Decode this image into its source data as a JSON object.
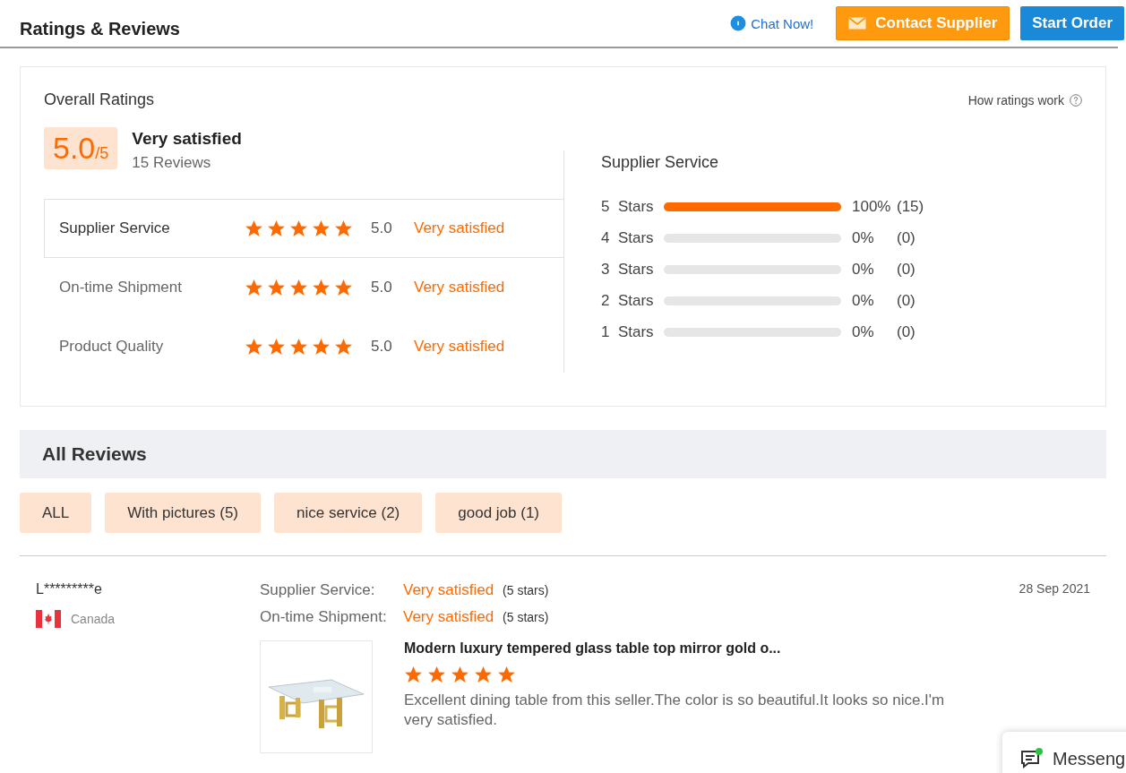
{
  "header": {
    "title": "Ratings & Reviews",
    "chat_link": "Chat Now!",
    "contact_button": "Contact Supplier",
    "order_button": "Start Order"
  },
  "overall": {
    "title": "Overall Ratings",
    "help_link": "How ratings work",
    "score": "5.0",
    "score_max": "/5",
    "verdict": "Very satisfied",
    "review_count": "15 Reviews",
    "criteria": [
      {
        "name": "Supplier Service",
        "stars": 5,
        "score": "5.0",
        "verdict": "Very satisfied",
        "selected": true
      },
      {
        "name": "On-time Shipment",
        "stars": 5,
        "score": "5.0",
        "verdict": "Very satisfied",
        "selected": false
      },
      {
        "name": "Product Quality",
        "stars": 5,
        "score": "5.0",
        "verdict": "Very satisfied",
        "selected": false
      }
    ],
    "breakdown": {
      "title": "Supplier Service",
      "rows": [
        {
          "label": "5  Stars",
          "level": 1,
          "percent": "100%",
          "count": "(15)"
        },
        {
          "label": "4  Stars",
          "level": 0,
          "percent": "0%",
          "count": "(0)"
        },
        {
          "label": "3  Stars",
          "level": 0,
          "percent": "0%",
          "count": "(0)"
        },
        {
          "label": "2  Stars",
          "level": 0,
          "percent": "0%",
          "count": "(0)"
        },
        {
          "label": "1  Stars",
          "level": 0,
          "percent": "0%",
          "count": "(0)"
        }
      ]
    }
  },
  "all_reviews": {
    "title": "All Reviews",
    "filters": [
      "ALL",
      "With pictures (5)",
      "nice service (2)",
      "good job (1)"
    ]
  },
  "reviews": [
    {
      "user": "L*********e",
      "country": "Canada",
      "date": "28 Sep 2021",
      "ratings": [
        {
          "label": "Supplier Service:",
          "verdict": "Very satisfied",
          "stars_text": "(5 stars)"
        },
        {
          "label": "On-time Shipment:",
          "verdict": "Very satisfied",
          "stars_text": "(5 stars)"
        }
      ],
      "product": {
        "kind": "picture",
        "title": "Modern luxury tempered glass table top mirror gold o...",
        "stars": 5
      },
      "text": "Excellent dining table from this seller.The color is so beautiful.It looks so nice.I'm very satisfied."
    }
  ],
  "messenger": {
    "label": "Messeng",
    "online": true
  }
}
